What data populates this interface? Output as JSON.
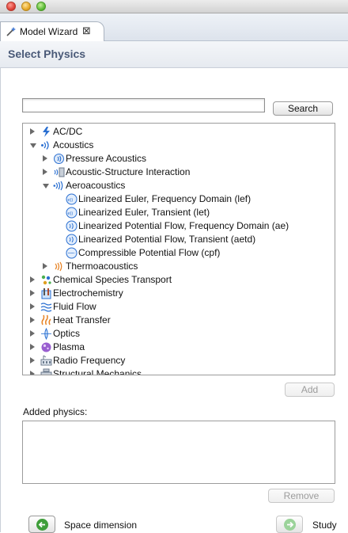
{
  "window": {
    "tab_title": "Model Wizard",
    "close_glyph": "⊠"
  },
  "page": {
    "title": "Select Physics"
  },
  "search": {
    "value": "",
    "placeholder": "",
    "button_label": "Search"
  },
  "tree": [
    {
      "label": "AC/DC",
      "level": 0,
      "toggle": "collapsed",
      "icon": "lightning-icon"
    },
    {
      "label": "Acoustics",
      "level": 0,
      "toggle": "expanded",
      "icon": "acoustics-icon"
    },
    {
      "label": "Pressure Acoustics",
      "level": 1,
      "toggle": "collapsed",
      "icon": "pressure-acoustics-icon"
    },
    {
      "label": "Acoustic-Structure Interaction",
      "level": 1,
      "toggle": "collapsed",
      "icon": "acoustic-structure-icon"
    },
    {
      "label": "Aeroacoustics",
      "level": 1,
      "toggle": "expanded",
      "icon": "aeroacoustics-icon"
    },
    {
      "label": "Linearized Euler, Frequency Domain (lef)",
      "level": 2,
      "toggle": "none",
      "icon": "linearized-euler-fd-icon"
    },
    {
      "label": "Linearized Euler, Transient (let)",
      "level": 2,
      "toggle": "none",
      "icon": "linearized-euler-transient-icon"
    },
    {
      "label": "Linearized Potential Flow, Frequency Domain (ae)",
      "level": 2,
      "toggle": "none",
      "icon": "linearized-potential-fd-icon"
    },
    {
      "label": "Linearized Potential Flow, Transient (aetd)",
      "level": 2,
      "toggle": "none",
      "icon": "linearized-potential-transient-icon"
    },
    {
      "label": "Compressible Potential Flow (cpf)",
      "level": 2,
      "toggle": "none",
      "icon": "compressible-potential-icon"
    },
    {
      "label": "Thermoacoustics",
      "level": 1,
      "toggle": "collapsed",
      "icon": "thermoacoustics-icon"
    },
    {
      "label": "Chemical Species Transport",
      "level": 0,
      "toggle": "collapsed",
      "icon": "chemical-species-icon"
    },
    {
      "label": "Electrochemistry",
      "level": 0,
      "toggle": "collapsed",
      "icon": "electrochemistry-icon"
    },
    {
      "label": "Fluid Flow",
      "level": 0,
      "toggle": "collapsed",
      "icon": "fluid-flow-icon"
    },
    {
      "label": "Heat Transfer",
      "level": 0,
      "toggle": "collapsed",
      "icon": "heat-transfer-icon"
    },
    {
      "label": "Optics",
      "level": 0,
      "toggle": "collapsed",
      "icon": "optics-icon"
    },
    {
      "label": "Plasma",
      "level": 0,
      "toggle": "collapsed",
      "icon": "plasma-icon"
    },
    {
      "label": "Radio Frequency",
      "level": 0,
      "toggle": "collapsed",
      "icon": "radio-frequency-icon"
    },
    {
      "label": "Structural Mechanics",
      "level": 0,
      "toggle": "collapsed",
      "icon": "structural-mechanics-icon"
    }
  ],
  "buttons": {
    "add": "Add",
    "remove": "Remove"
  },
  "added_physics": {
    "label": "Added physics:"
  },
  "footer": {
    "back_label": "Space dimension",
    "next_label": "Study"
  },
  "colors": {
    "header_title": "#4a5a78",
    "acoustic_blue": "#2a6fd1",
    "nav_green": "#3f9e3a"
  }
}
